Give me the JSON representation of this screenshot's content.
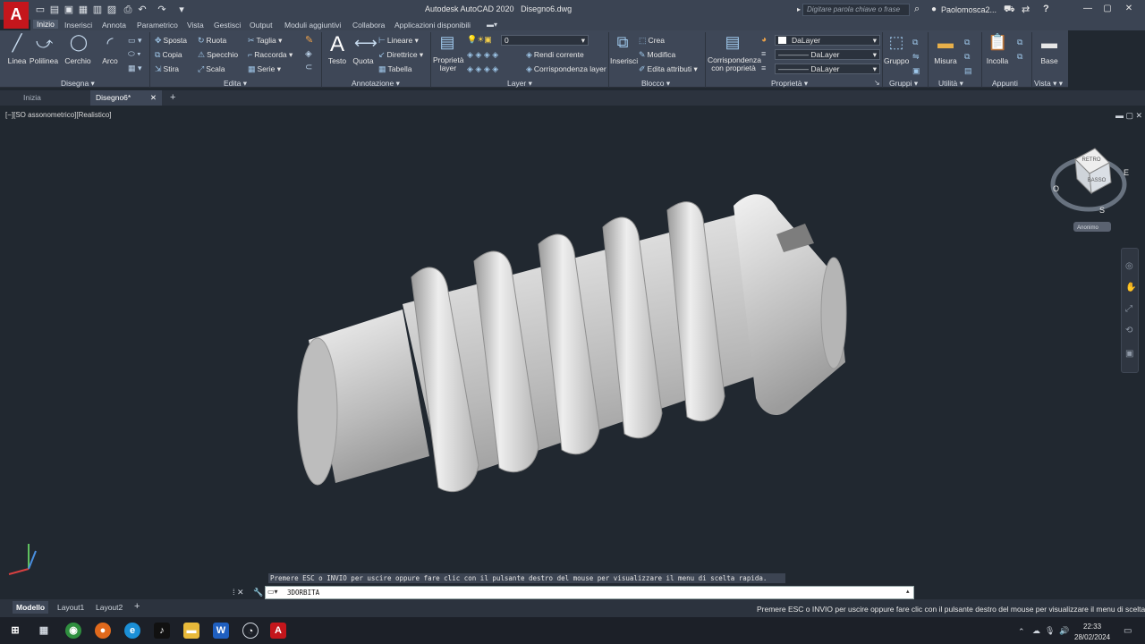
{
  "app": {
    "logo": "A",
    "title": "Autodesk AutoCAD 2020",
    "file": "Disegno6.dwg"
  },
  "search": {
    "placeholder": "Digitare parola chiave o frase"
  },
  "user": {
    "name": "Paolomosca2..."
  },
  "ribbon_tabs": [
    "Inizio",
    "Inserisci",
    "Annota",
    "Parametrico",
    "Vista",
    "Gestisci",
    "Output",
    "Moduli aggiuntivi",
    "Collabora",
    "Applicazioni disponibili"
  ],
  "panels": {
    "disegna": {
      "label": "Disegna ▾",
      "tools": [
        "Linea",
        "Polilinea",
        "Cerchio",
        "Arco"
      ]
    },
    "edita": {
      "label": "Edita ▾",
      "tools": [
        "Sposta",
        "Ruota",
        "Taglia",
        "Copia",
        "Specchio",
        "Raccorda",
        "Stira",
        "Scala",
        "Serie"
      ]
    },
    "annotazione": {
      "label": "Annotazione ▾",
      "tools": [
        "Testo",
        "Quota",
        "Lineare",
        "Direttrice",
        "Tabella"
      ]
    },
    "layer": {
      "label": "Layer ▾",
      "prop_label": "Proprietà layer",
      "current_layer": "0",
      "tools": [
        "Rendi corrente",
        "Corrispondenza layer"
      ]
    },
    "blocco": {
      "label": "Blocco ▾",
      "insert_label": "Inserisci",
      "tools": [
        "Crea",
        "Modifica",
        "Edita attributi"
      ]
    },
    "proprieta": {
      "label": "Proprietà ▾",
      "match_label": "Corrispondenza con proprietà",
      "combos": [
        "DaLayer",
        "DaLayer",
        "DaLayer"
      ]
    },
    "gruppi": {
      "label": "Gruppi ▾",
      "tool": "Gruppo"
    },
    "utilita": {
      "label": "Utilità ▾",
      "tool": "Misura"
    },
    "appunti": {
      "label": "Appunti",
      "tool": "Incolla"
    },
    "vista": {
      "label": "Vista ▾",
      "tool": "Base"
    }
  },
  "doc_tabs": [
    "Inizia",
    "Disegno6*"
  ],
  "viewport": {
    "label": "[−][SO assonometrico][Realistico]"
  },
  "viewcube": {
    "top": "RETRO",
    "face": "BASSO",
    "east": "E",
    "south": "S",
    "west": "O",
    "view_name": "Anonimo"
  },
  "command": {
    "message": "Premere ESC o INVIO per uscire oppure fare clic con il pulsante destro del mouse per visualizzare il menu di scelta rapida.",
    "input": "3DORBITA"
  },
  "layout_tabs": [
    "Modello",
    "Layout1",
    "Layout2"
  ],
  "status_message": "Premere ESC o INVIO per uscire oppure fare clic con il pulsante destro del mouse per visualizzare il menu di scelta rapida.",
  "clock": {
    "time": "22:33",
    "date": "28/02/2024"
  },
  "colors": {
    "brand": "#c4161c",
    "ribbon": "#3e4757",
    "viewport": "#212830"
  }
}
